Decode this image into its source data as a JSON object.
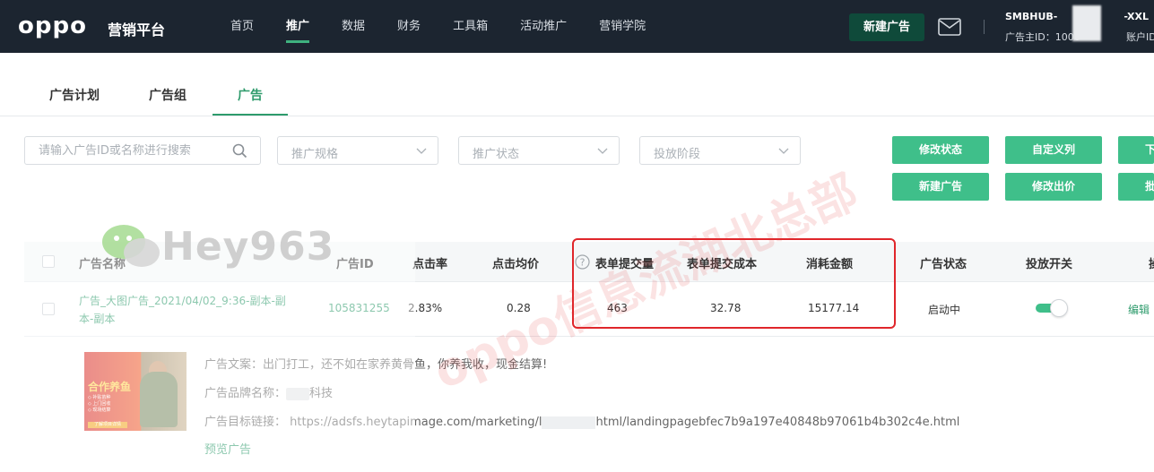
{
  "topbar": {
    "logo": "oppo",
    "platform": "营销平台",
    "nav": [
      "首页",
      "推广",
      "数据",
      "财务",
      "工具箱",
      "活动推广",
      "营销学院"
    ],
    "active_nav": "推广",
    "new_ad_button": "新建广告",
    "account_name_prefix": "SMBHUB-",
    "account_name_suffix": "-XXL",
    "advertiser_id_label": "广告主ID：1000",
    "account_id_label": "账户ID"
  },
  "tabs": {
    "items": [
      "广告计划",
      "广告组",
      "广告"
    ],
    "active": "广告"
  },
  "filters": {
    "search_placeholder": "请输入广告ID或名称进行搜索",
    "spec_placeholder": "推广规格",
    "status_placeholder": "推广状态",
    "stage_placeholder": "投放阶段"
  },
  "actions": {
    "row1": [
      "修改状态",
      "自定义列",
      "下"
    ],
    "row2": [
      "新建广告",
      "修改出价",
      "批"
    ]
  },
  "table": {
    "headers": {
      "name": "广告名称",
      "id": "广告ID",
      "ctr": "点击率",
      "cpc": "点击均价",
      "forms": "表单提交量",
      "form_cost": "表单提交成本",
      "spend": "消耗金额",
      "status": "广告状态",
      "switch": "投放开关",
      "ops": "操"
    },
    "rows": [
      {
        "name_line1": "广告_大图广告_2021/04/02_9:36-副本-副",
        "name_line2": "本-副本",
        "id": "105831255",
        "ctr": "2.83%",
        "cpc": "0.28",
        "forms": "463",
        "form_cost": "32.78",
        "spend": "15177.14",
        "status": "启动中",
        "switch_on": true,
        "ops": "编辑"
      }
    ]
  },
  "detail": {
    "copy_label": "广告文案：",
    "copy_value": "出门打工，还不如在家养黄骨鱼，你养我收，现金结算!",
    "brand_label": "广告品牌名称：",
    "brand_value": "科技",
    "link_label": "广告目标链接：",
    "link_value_start": "https://adsfs.heytapimage.com/marketing/l",
    "link_value_end": "html/landingpagebfec7b9a197e40848b97061b4b302c4e.html",
    "preview": "预览广告",
    "thumb_title": "合作养鱼",
    "thumb_bullets": [
      "◇ 补贴苗种",
      "◇ 上门回收",
      "◇ 现场结算"
    ],
    "thumb_banner": "了解项目详情"
  },
  "watermarks": {
    "hey": "Hey963",
    "red": "oppo信息流湖北总部"
  },
  "colors": {
    "topbar": "#1c2530",
    "accent_green": "#3fbf8a",
    "link_green": "#2e9b6c",
    "highlight_red": "#e0262b"
  }
}
